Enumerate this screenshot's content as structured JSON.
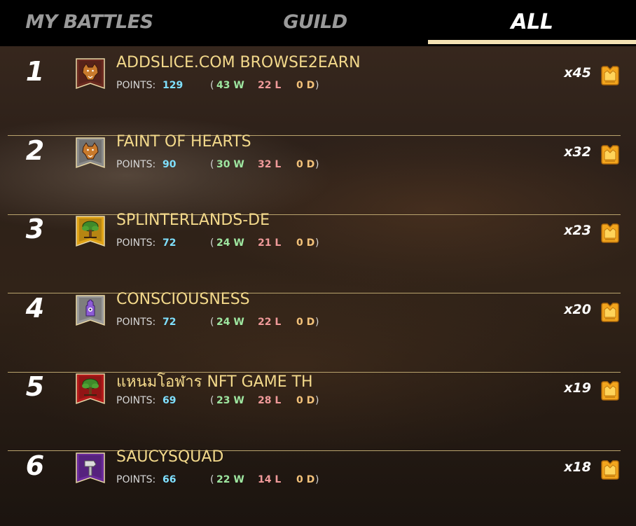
{
  "tabs": [
    {
      "label": "MY BATTLES",
      "active": false
    },
    {
      "label": "GUILD",
      "active": false
    },
    {
      "label": "ALL",
      "active": true
    }
  ],
  "colors": {
    "name": "#f3d98b",
    "points": "#7fe0ff",
    "wins": "#9ee6a0",
    "losses": "#f09a9a",
    "draws": "#f3c27a",
    "underline": "#f4e2b4"
  },
  "rows": [
    {
      "rank": "1",
      "name": "ADDSLICE.COM BROWSE2EARN",
      "points_label": "POINTS:",
      "points": "129",
      "open": "(",
      "wins": "43 W",
      "losses": "22 L",
      "draws": "0 D",
      "close": ")",
      "reward": "x45",
      "banner_icon": "wolf-icon",
      "banner_color": "#6b2a1f"
    },
    {
      "rank": "2",
      "name": "FAINT OF HEARTS",
      "points_label": "POINTS:",
      "points": "90",
      "open": "(",
      "wins": "30 W",
      "losses": "32 L",
      "draws": "0 D",
      "close": ")",
      "reward": "x32",
      "banner_icon": "wolf-icon",
      "banner_color": "#8a8a8a"
    },
    {
      "rank": "3",
      "name": "SPLINTERLANDS-DE",
      "points_label": "POINTS:",
      "points": "72",
      "open": "(",
      "wins": "24 W",
      "losses": "21 L",
      "draws": "0 D",
      "close": ")",
      "reward": "x23",
      "banner_icon": "tree-icon",
      "banner_color": "#e0a316"
    },
    {
      "rank": "4",
      "name": "CONSCIOUSNESS",
      "points_label": "POINTS:",
      "points": "72",
      "open": "(",
      "wins": "24 W",
      "losses": "22 L",
      "draws": "0 D",
      "close": ")",
      "reward": "x20",
      "banner_icon": "hand-icon",
      "banner_color": "#9a9a9a"
    },
    {
      "rank": "5",
      "name": "แหนมโอฬาร NFT GAME TH",
      "points_label": "POINTS:",
      "points": "69",
      "open": "(",
      "wins": "23 W",
      "losses": "28 L",
      "draws": "0 D",
      "close": ")",
      "reward": "x19",
      "banner_icon": "tree-icon",
      "banner_color": "#b31a1a"
    },
    {
      "rank": "6",
      "name": "SAUCYSQUAD",
      "points_label": "POINTS:",
      "points": "66",
      "open": "(",
      "wins": "22 W",
      "losses": "14 L",
      "draws": "0 D",
      "close": ")",
      "reward": "x18",
      "banner_icon": "hammer-icon",
      "banner_color": "#6a2a9a"
    }
  ],
  "reward_icon": "merit-crown-icon"
}
